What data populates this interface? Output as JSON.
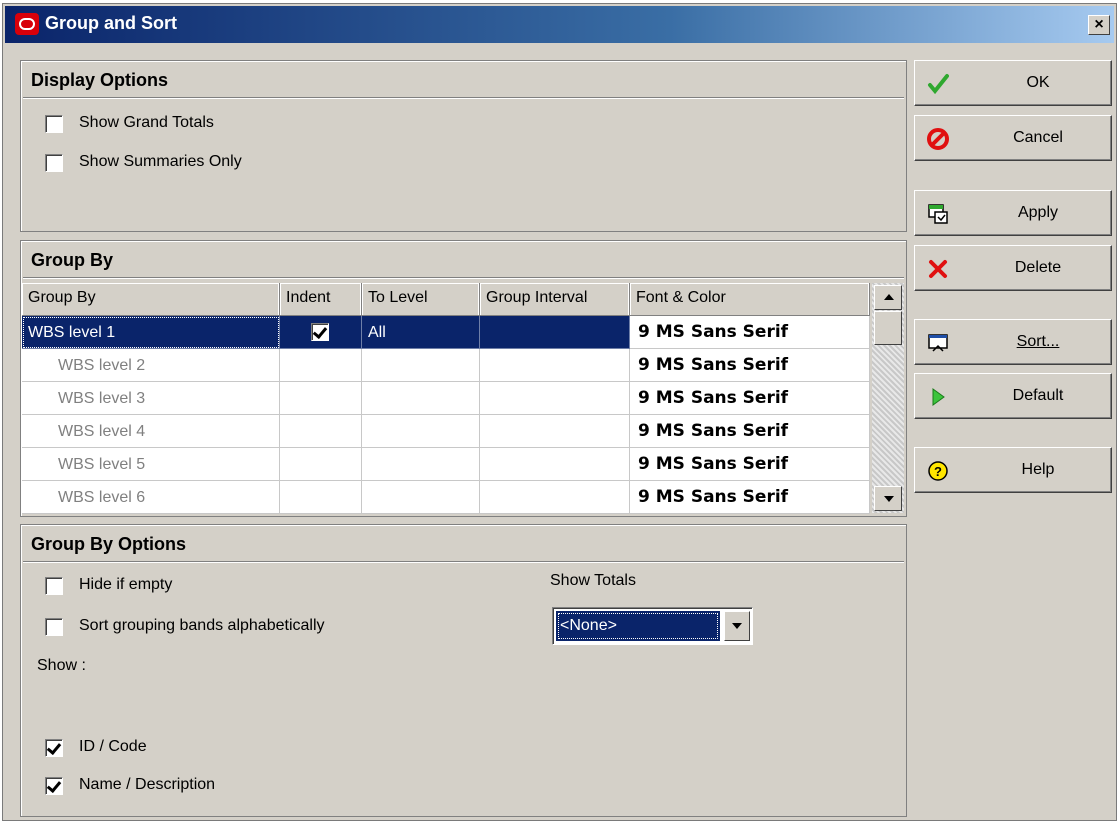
{
  "window": {
    "title": "Group and Sort",
    "close_label": "×"
  },
  "display_options": {
    "header": "Display Options",
    "show_grand_totals": {
      "label": "Show Grand Totals",
      "checked": false
    },
    "show_summaries_only": {
      "label": "Show Summaries Only",
      "checked": false
    }
  },
  "group_by": {
    "header": "Group By",
    "columns": [
      "Group By",
      "Indent",
      "To Level",
      "Group Interval",
      "Font & Color"
    ],
    "rows": [
      {
        "group_by": "WBS level 1",
        "indent": true,
        "to_level": "All",
        "group_interval": "",
        "font_color": "9 MS Sans Serif"
      },
      {
        "group_by": "WBS level 2",
        "indent": false,
        "to_level": "",
        "group_interval": "",
        "font_color": "9 MS Sans Serif"
      },
      {
        "group_by": "WBS level 3",
        "indent": false,
        "to_level": "",
        "group_interval": "",
        "font_color": "9 MS Sans Serif"
      },
      {
        "group_by": "WBS level 4",
        "indent": false,
        "to_level": "",
        "group_interval": "",
        "font_color": "9 MS Sans Serif"
      },
      {
        "group_by": "WBS level 5",
        "indent": false,
        "to_level": "",
        "group_interval": "",
        "font_color": "9 MS Sans Serif"
      },
      {
        "group_by": "WBS level 6",
        "indent": false,
        "to_level": "",
        "group_interval": "",
        "font_color": "9 MS Sans Serif"
      }
    ]
  },
  "group_by_options": {
    "header": "Group By Options",
    "hide_if_empty": {
      "label": "Hide if empty",
      "checked": false
    },
    "sort_alpha": {
      "label": "Sort grouping bands alphabetically",
      "checked": false
    },
    "show_label": "Show :",
    "id_code": {
      "label": "ID / Code",
      "checked": true
    },
    "name_desc": {
      "label": "Name / Description",
      "checked": true
    },
    "show_totals_label": "Show Totals",
    "show_totals_value": "<None>"
  },
  "buttons": {
    "ok": "OK",
    "cancel": "Cancel",
    "apply": "Apply",
    "delete": "Delete",
    "sort": "Sort...",
    "default": "Default",
    "help": "Help"
  },
  "colors": {
    "selection": "#0a246a",
    "face": "#d4d0c8",
    "ok_check": "#2fa82f",
    "cancel_red": "#e01010"
  }
}
